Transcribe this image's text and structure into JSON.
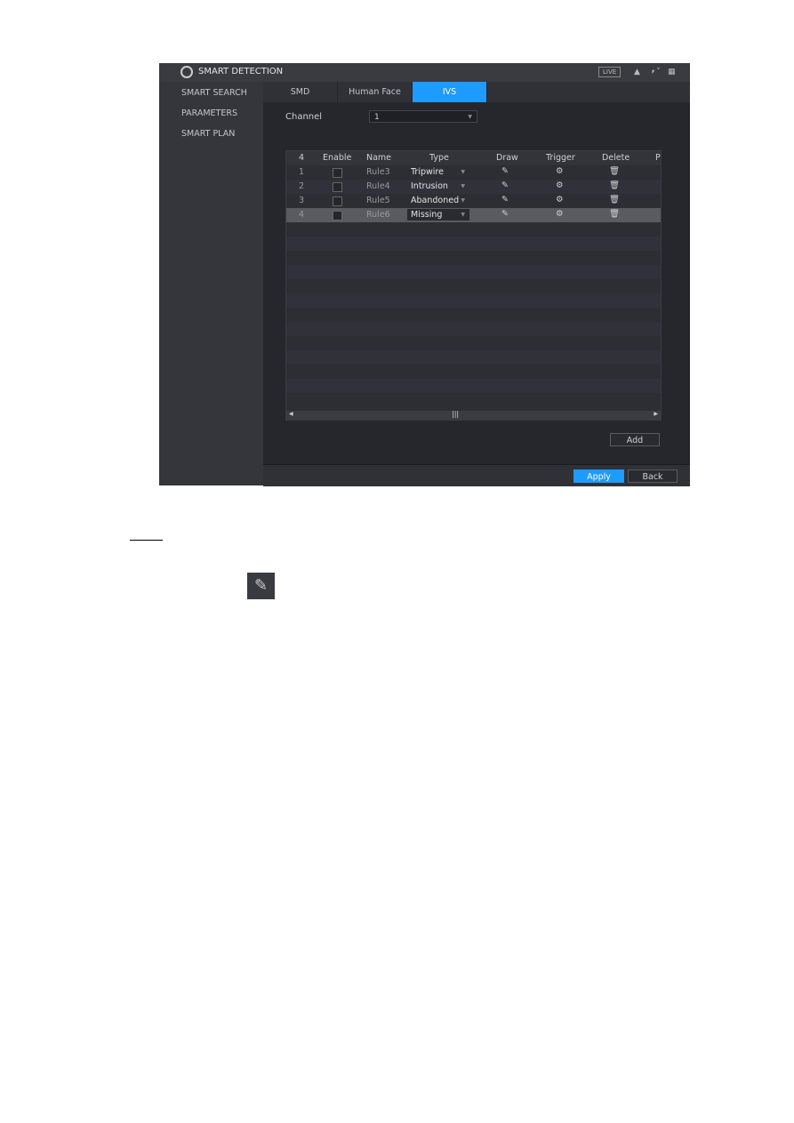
{
  "header": {
    "title": "SMART DETECTION",
    "live": "LIVE"
  },
  "sidebar": {
    "items": [
      {
        "label": "SMART SEARCH"
      },
      {
        "label": "PARAMETERS"
      },
      {
        "label": "SMART PLAN"
      }
    ]
  },
  "tabs": [
    {
      "label": "SMD"
    },
    {
      "label": "Human Face"
    },
    {
      "label": "IVS",
      "active": true
    }
  ],
  "channel": {
    "label": "Channel",
    "value": "1"
  },
  "table": {
    "columns": [
      "4",
      "Enable",
      "Name",
      "Type",
      "Draw",
      "Trigger",
      "Delete",
      "P"
    ],
    "rows": [
      {
        "no": "1",
        "name": "Rule3",
        "type": "Tripwire",
        "enabled": false
      },
      {
        "no": "2",
        "name": "Rule4",
        "type": "Intrusion",
        "enabled": false
      },
      {
        "no": "3",
        "name": "Rule5",
        "type": "Abandoned",
        "enabled": false
      },
      {
        "no": "4",
        "name": "Rule6",
        "type": "Missing",
        "enabled": false,
        "selected": true
      }
    ]
  },
  "buttons": {
    "add": "Add",
    "apply": "Apply",
    "back": "Back"
  },
  "colors": {
    "accent": "#1e9bff",
    "panel": "#2b2c32"
  },
  "icons": {
    "draw": "pencil-icon",
    "trigger": "gear-icon",
    "delete": "trash-icon"
  }
}
